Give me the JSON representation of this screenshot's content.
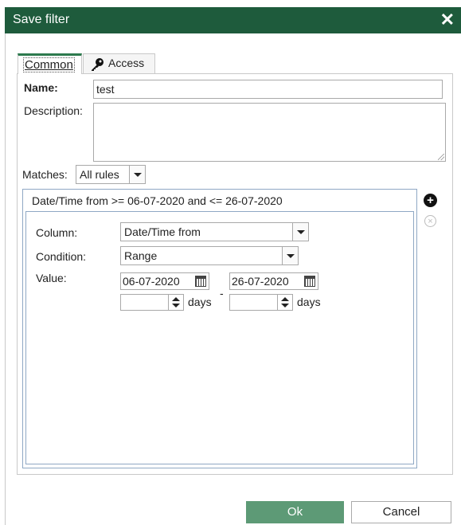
{
  "dialog": {
    "title": "Save filter",
    "close_glyph": "✕"
  },
  "tabs": [
    {
      "label": "Common"
    },
    {
      "label": "Access",
      "icon": "key-icon"
    }
  ],
  "form": {
    "name_label": "Name:",
    "name_value": "test",
    "description_label": "Description:",
    "description_value": "",
    "matches_label": "Matches:",
    "matches_value": "All rules"
  },
  "rule": {
    "summary": "Date/Time from >= 06-07-2020 and <= 26-07-2020",
    "column_label": "Column:",
    "column_value": "Date/Time from",
    "condition_label": "Condition:",
    "condition_value": "Range",
    "value_label": "Value:",
    "date_from": "06-07-2020",
    "date_to": "26-07-2020",
    "days_from": "",
    "days_to": "",
    "days_unit": "days",
    "range_sep": "-"
  },
  "buttons": {
    "add_glyph": "+",
    "remove_glyph": "×",
    "ok": "Ok",
    "cancel": "Cancel"
  },
  "colors": {
    "titlebar": "#1e5b3c",
    "ok_button": "#5d9a76",
    "rule_border": "#8fa8c4"
  }
}
